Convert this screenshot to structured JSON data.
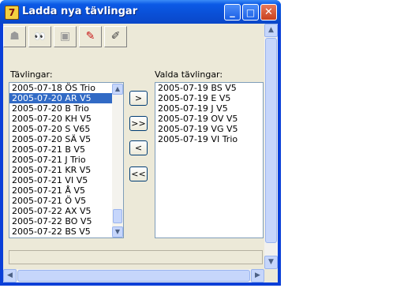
{
  "window": {
    "title": "Ladda nya tävlingar"
  },
  "titlebar_buttons": {
    "minimize": "_",
    "maximize": "□",
    "close": "✕"
  },
  "toolbar": [
    {
      "icon": "export-icon",
      "glyph": "☗",
      "enabled": false
    },
    {
      "icon": "binoculars-icon",
      "glyph": "👀",
      "enabled": true
    },
    {
      "icon": "save-icon",
      "glyph": "▣",
      "enabled": false
    },
    {
      "icon": "pen-icon",
      "glyph": "✎",
      "enabled": true
    },
    {
      "icon": "eraser-icon",
      "glyph": "✐",
      "enabled": true
    }
  ],
  "available": {
    "label": "Tävlingar:",
    "items": [
      "2005-07-18 ÖS Trio",
      "2005-07-20 AR V5",
      "2005-07-20 B  Trio",
      "2005-07-20 KH V5",
      "2005-07-20 S  V65",
      "2005-07-20 SÄ V5",
      "2005-07-21 B  V5",
      "2005-07-21 J  Trio",
      "2005-07-21 KR V5",
      "2005-07-21 VI V5",
      "2005-07-21 Å  V5",
      "2005-07-21 Ö  V5",
      "2005-07-22 AX V5",
      "2005-07-22 BO V5",
      "2005-07-22 BS V5"
    ],
    "selected_index": 1
  },
  "buttons": {
    "add": ">",
    "add_all": ">>",
    "remove": "<",
    "remove_all": "<<"
  },
  "chosen": {
    "label": "Valda tävlingar:",
    "items": [
      "2005-07-19 BS V5",
      "2005-07-19 E  V5",
      "2005-07-19 J  V5",
      "2005-07-19 OV V5",
      "2005-07-19 VG V5",
      "2005-07-19 VI Trio"
    ]
  },
  "colors": {
    "titlebar": "#0a4fd6",
    "selection": "#316ac5",
    "face": "#ece9d8"
  }
}
